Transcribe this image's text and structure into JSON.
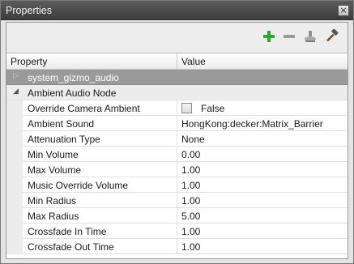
{
  "window": {
    "title": "Properties",
    "close_icon": "×"
  },
  "toolbar": {
    "add_icon": "add-icon",
    "remove_icon": "remove-icon",
    "stamp_icon": "stamp-icon",
    "hammer_icon": "hammer-icon",
    "colors": {
      "add": "#2fa82f",
      "remove": "#9a9a9a"
    }
  },
  "grid": {
    "headers": {
      "property": "Property",
      "value": "Value"
    },
    "categories": [
      {
        "label": "system_gizmo_audio",
        "expanded": false
      },
      {
        "label": "Ambient Audio Node",
        "expanded": true
      }
    ],
    "rows": [
      {
        "property": "Override Camera Ambient",
        "value": "False",
        "checkbox": true,
        "checked": false
      },
      {
        "property": "Ambient Sound",
        "value": "HongKong:decker:Matrix_Barrier"
      },
      {
        "property": "Attenuation Type",
        "value": "None"
      },
      {
        "property": "Min Volume",
        "value": "0.00"
      },
      {
        "property": "Max Volume",
        "value": "1.00"
      },
      {
        "property": "Music Override Volume",
        "value": "1.00"
      },
      {
        "property": "Min Radius",
        "value": "1.00"
      },
      {
        "property": "Max Radius",
        "value": "5.00"
      },
      {
        "property": "Crossfade In Time",
        "value": "1.00"
      },
      {
        "property": "Crossfade Out Time",
        "value": "1.00"
      }
    ]
  }
}
